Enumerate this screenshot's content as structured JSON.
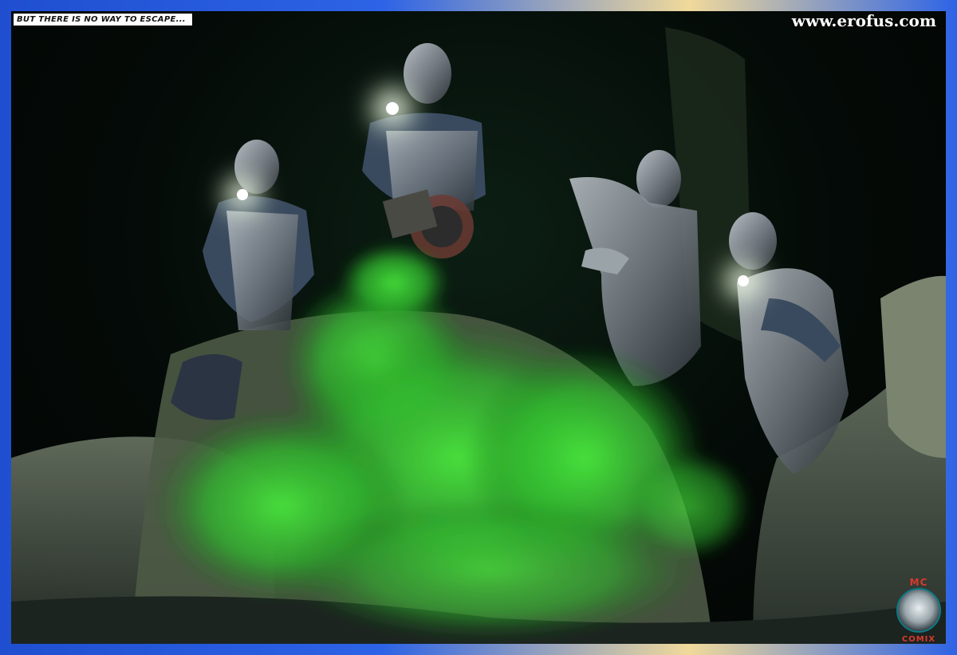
{
  "caption": "BUT THERE IS NO WAY TO ESCAPE...",
  "watermark": "www.erofus.com",
  "logo": {
    "top": "MC",
    "bottom": "COMIX"
  },
  "colors": {
    "frame": "#2d63e6",
    "smoke": "#3ed63a",
    "background": "#050b08",
    "armor": "#8d949a"
  }
}
